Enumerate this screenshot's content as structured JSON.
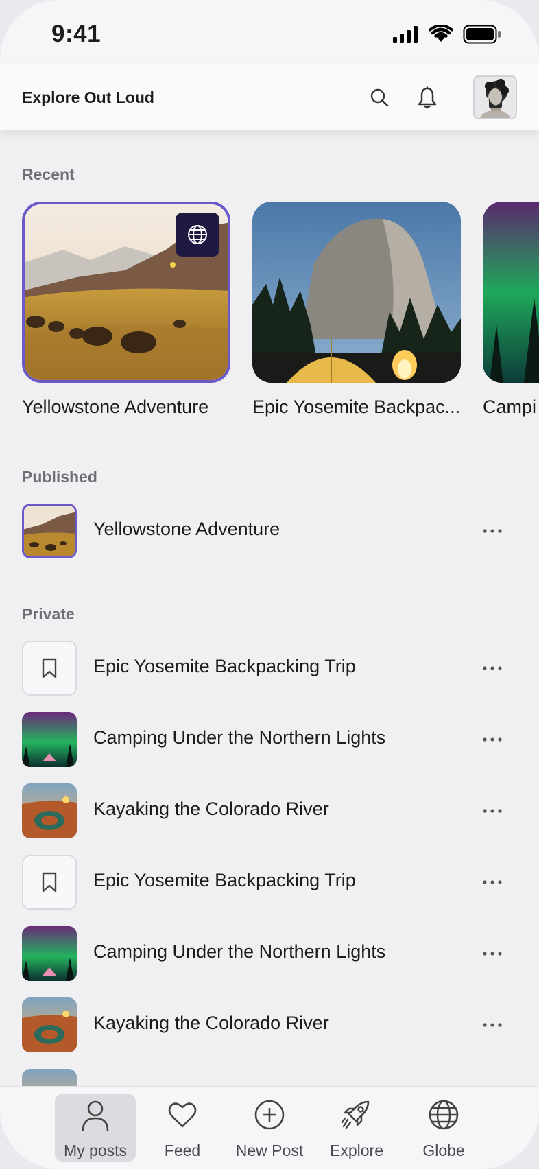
{
  "status_bar": {
    "time": "9:41"
  },
  "header": {
    "title": "Explore Out Loud"
  },
  "sections": {
    "recent": "Recent",
    "published": "Published",
    "private": "Private"
  },
  "recent": [
    {
      "title": "Yellowstone Adventure",
      "scene": "yellowstone",
      "selected": true
    },
    {
      "title": "Epic Yosemite Backpac...",
      "scene": "yosemite",
      "selected": false
    },
    {
      "title": "Campi",
      "scene": "aurora",
      "selected": false
    }
  ],
  "published": [
    {
      "title": "Yellowstone Adventure",
      "thumb": "yellowstone"
    }
  ],
  "private": [
    {
      "title": "Epic Yosemite Backpacking Trip",
      "thumb": "bookmark-icon"
    },
    {
      "title": "Camping Under the Northern Lights",
      "thumb": "aurora"
    },
    {
      "title": "Kayaking the Colorado River",
      "thumb": "canyon"
    },
    {
      "title": "Epic Yosemite Backpacking Trip",
      "thumb": "bookmark-icon"
    },
    {
      "title": "Camping Under the Northern Lights",
      "thumb": "aurora"
    },
    {
      "title": "Kayaking the Colorado River",
      "thumb": "canyon"
    }
  ],
  "tabs": [
    {
      "label": "My posts",
      "icon": "person-icon",
      "active": true
    },
    {
      "label": "Feed",
      "icon": "heart-icon",
      "active": false
    },
    {
      "label": "New Post",
      "icon": "plus-circle-icon",
      "active": false
    },
    {
      "label": "Explore",
      "icon": "rocket-icon",
      "active": false
    },
    {
      "label": "Globe",
      "icon": "globe-icon",
      "active": false
    }
  ],
  "colors": {
    "accent": "#6b58c9",
    "badge": "#1e1a42"
  }
}
